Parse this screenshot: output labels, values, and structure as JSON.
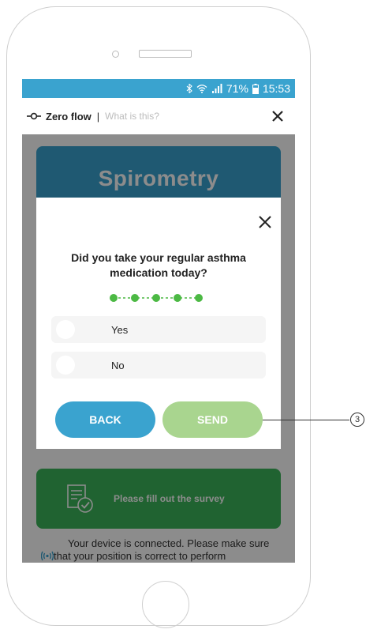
{
  "status_bar": {
    "battery_percent": "71%",
    "time": "15:53",
    "icons": [
      "bluetooth-icon",
      "wifi-icon",
      "signal-icon",
      "battery-icon"
    ]
  },
  "app_bar": {
    "title": "Zero flow",
    "separator": "|",
    "help_link": "What is this?",
    "close_icon": "close-icon"
  },
  "background": {
    "card_title": "Spirometry",
    "survey_prompt": "Please fill out the survey",
    "connection_line1": "Your device is connected. Please make sure",
    "connection_line2": "that your position is correct to perform"
  },
  "modal": {
    "question_line1": "Did you take your regular asthma",
    "question_line2": "medication today?",
    "progress_steps": 5,
    "answers": [
      {
        "label": "Yes"
      },
      {
        "label": "No"
      }
    ],
    "back_label": "BACK",
    "send_label": "SEND"
  },
  "callout": {
    "number": "3"
  },
  "colors": {
    "brand_blue": "#3aa3cf",
    "progress_green": "#4cb944",
    "send_disabled": "#a9d58f",
    "survey_green": "#3bb55a"
  }
}
